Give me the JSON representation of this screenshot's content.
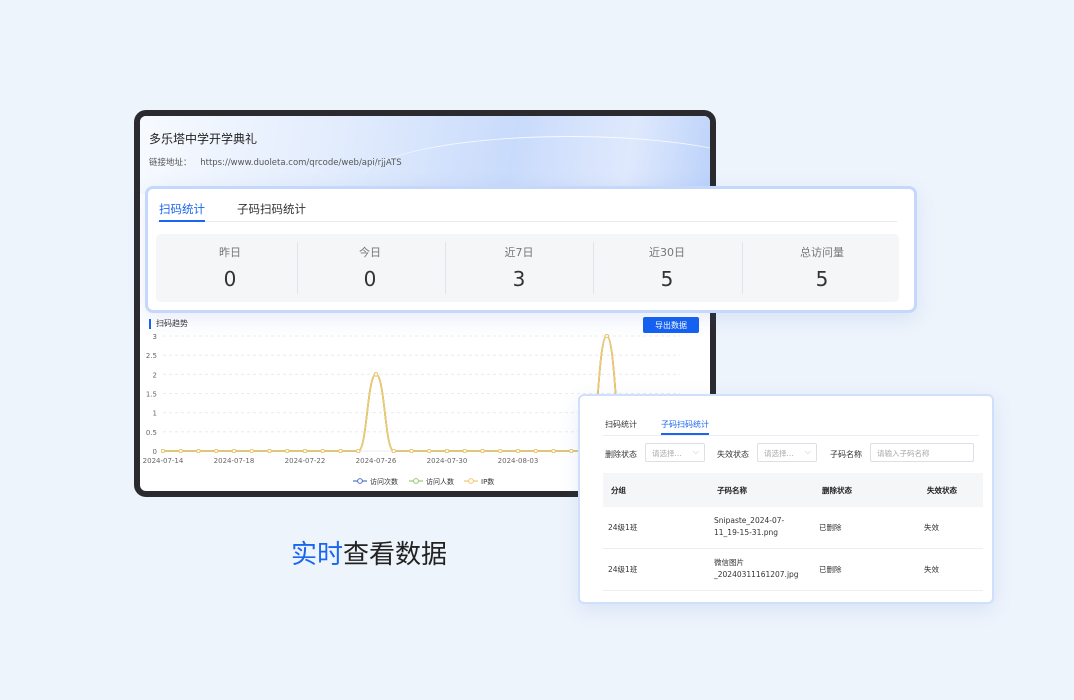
{
  "screen": {
    "title": "多乐塔中学开学典礼",
    "link_label": "链接地址：",
    "link_url": "https://www.duoleta.com/qrcode/web/api/rjjATS"
  },
  "stats_card": {
    "tabs": [
      "扫码统计",
      "子码扫码统计"
    ],
    "active_tab": 0,
    "stats": [
      {
        "label": "昨日",
        "value": "0"
      },
      {
        "label": "今日",
        "value": "0"
      },
      {
        "label": "近7日",
        "value": "3"
      },
      {
        "label": "近30日",
        "value": "5"
      },
      {
        "label": "总访问量",
        "value": "5"
      }
    ]
  },
  "trend": {
    "title": "扫码趋势",
    "export_label": "导出数据"
  },
  "chart_data": {
    "type": "line",
    "title": "扫码趋势",
    "x_tick_labels": [
      "2024-07-14",
      "2024-07-18",
      "2024-07-22",
      "2024-07-26",
      "2024-07-30",
      "2024-08-03",
      "20"
    ],
    "y_ticks": [
      "0",
      "0.5",
      "1",
      "1.5",
      "2",
      "2.5",
      "3"
    ],
    "ylim": [
      0,
      3
    ],
    "x": [
      "2024-07-14",
      "2024-07-15",
      "2024-07-16",
      "2024-07-17",
      "2024-07-18",
      "2024-07-19",
      "2024-07-20",
      "2024-07-21",
      "2024-07-22",
      "2024-07-23",
      "2024-07-24",
      "2024-07-25",
      "2024-07-26",
      "2024-07-27",
      "2024-07-28",
      "2024-07-29",
      "2024-07-30",
      "2024-07-31",
      "2024-08-01",
      "2024-08-02",
      "2024-08-03",
      "2024-08-04",
      "2024-08-05",
      "2024-08-06",
      "2024-08-07",
      "2024-08-08",
      "2024-08-09"
    ],
    "series": [
      {
        "name": "访问次数",
        "color": "#5470c6",
        "values": [
          0,
          0,
          0,
          0,
          0,
          0,
          0,
          0,
          0,
          0,
          0,
          0,
          2,
          0,
          0,
          0,
          0,
          0,
          0,
          0,
          0,
          0,
          0,
          0,
          0,
          3,
          0
        ]
      },
      {
        "name": "访问人数",
        "color": "#91cc75",
        "values": [
          0,
          0,
          0,
          0,
          0,
          0,
          0,
          0,
          0,
          0,
          0,
          0,
          2,
          0,
          0,
          0,
          0,
          0,
          0,
          0,
          0,
          0,
          0,
          0,
          0,
          3,
          0
        ]
      },
      {
        "name": "IP数",
        "color": "#f4c86b",
        "values": [
          0,
          0,
          0,
          0,
          0,
          0,
          0,
          0,
          0,
          0,
          0,
          0,
          2,
          0,
          0,
          0,
          0,
          0,
          0,
          0,
          0,
          0,
          0,
          0,
          0,
          3,
          0
        ]
      }
    ],
    "grid": true,
    "legend": "bottom"
  },
  "tagline": {
    "highlight": "实时",
    "rest": "查看数据"
  },
  "sub_card": {
    "tabs": [
      "扫码统计",
      "子码扫码统计"
    ],
    "active_tab": 1,
    "filters": {
      "delete_label": "删除状态",
      "delete_placeholder": "请选择...",
      "invalid_label": "失效状态",
      "invalid_placeholder": "请选择...",
      "name_label": "子码名称",
      "name_placeholder": "请输入子码名称"
    },
    "columns": [
      "分组",
      "子码名称",
      "删除状态",
      "失效状态"
    ],
    "rows": [
      {
        "group": "24级1班",
        "name_line1": "Snipaste_2024-07-",
        "name_line2": "11_19-15-31.png",
        "deleted": "已删除",
        "invalid": "失效"
      },
      {
        "group": "24级1班",
        "name_line1": "微信图片",
        "name_line2": "_20240311161207.jpg",
        "deleted": "已删除",
        "invalid": "失效"
      }
    ]
  }
}
